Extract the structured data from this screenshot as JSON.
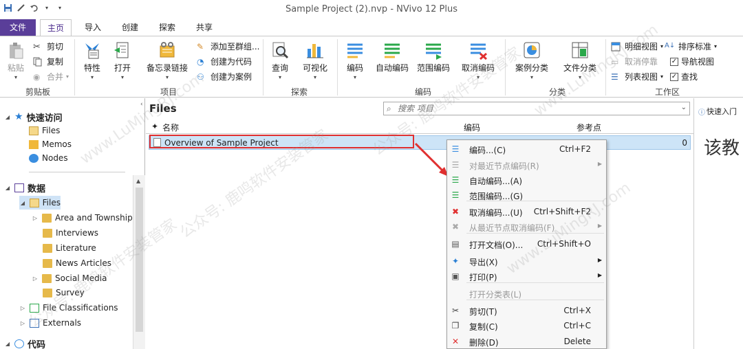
{
  "window": {
    "title": "Sample Project (2).nvp - NVivo 12 Plus"
  },
  "tabs": [
    "文件",
    "主页",
    "导入",
    "创建",
    "探索",
    "共享"
  ],
  "ribbon": {
    "clipboard": {
      "paste": "粘贴",
      "cut": "剪切",
      "copy": "复制",
      "merge": "合并",
      "group": "剪贴板"
    },
    "item": {
      "properties": "特性",
      "open": "打开",
      "memo_link": "备忘录链接",
      "add_to_group": "添加至群组...",
      "create_as_code": "创建为代码",
      "create_as_case": "创建为案例",
      "group": "项目"
    },
    "explore": {
      "query": "查询",
      "visualize": "可视化",
      "group": "探索"
    },
    "coding": {
      "code": "编码",
      "auto_code": "自动编码",
      "range_code": "范围编码",
      "uncode": "取消编码",
      "group": "编码"
    },
    "classify": {
      "case_classify": "案例分类",
      "file_classify": "文件分类",
      "group": "分类"
    },
    "workspace": {
      "detail_view": "明细视图",
      "sort": "排序标准",
      "undock": "取消停靠",
      "nav_view": "导航视图",
      "list_view": "列表视图",
      "find": "查找",
      "group": "工作区",
      "nav_view_checked": true,
      "find_checked": true
    }
  },
  "nav": {
    "quick_access": "快速访问",
    "quick_items": [
      "Files",
      "Memos",
      "Nodes"
    ],
    "data": "数据",
    "files": "Files",
    "subfolders": [
      "Area and Township",
      "Interviews",
      "Literature",
      "News Articles",
      "Social Media",
      "Survey"
    ],
    "file_classifications": "File Classifications",
    "externals": "Externals",
    "codes": "代码"
  },
  "main": {
    "title": "Files",
    "search_placeholder": "搜索 项目",
    "columns": {
      "name": "名称",
      "codes": "编码",
      "refs": "参考点"
    },
    "rows": [
      {
        "name": "Overview of Sample Project",
        "refs": "0"
      }
    ]
  },
  "context_menu": [
    {
      "label": "编码...(C)",
      "shortcut": "Ctrl+F2",
      "icon": "code-icon",
      "disabled": false,
      "sub": false
    },
    {
      "label": "对最近节点编码(R)",
      "shortcut": "",
      "icon": "recent-code-icon",
      "disabled": true,
      "sub": true
    },
    {
      "label": "自动编码...(A)",
      "shortcut": "",
      "icon": "auto-code-icon",
      "disabled": false,
      "sub": false
    },
    {
      "label": "范围编码...(G)",
      "shortcut": "",
      "icon": "range-code-icon",
      "disabled": false,
      "sub": false
    },
    {
      "label": "取消编码...(U)",
      "shortcut": "Ctrl+Shift+F2",
      "icon": "uncode-icon",
      "disabled": false,
      "sub": false
    },
    {
      "label": "从最近节点取消编码(F)",
      "shortcut": "",
      "icon": "recent-uncode-icon",
      "disabled": true,
      "sub": true
    },
    {
      "label": "打开文档(O)...",
      "shortcut": "Ctrl+Shift+O",
      "icon": "open-doc-icon",
      "disabled": false,
      "sub": false
    },
    {
      "label": "导出(X)",
      "shortcut": "",
      "icon": "export-icon",
      "disabled": false,
      "sub": true
    },
    {
      "label": "打印(P)",
      "shortcut": "",
      "icon": "print-icon",
      "disabled": false,
      "sub": true
    },
    {
      "label": "打开分类表(L)",
      "shortcut": "",
      "icon": "",
      "disabled": true,
      "sub": false
    },
    {
      "label": "剪切(T)",
      "shortcut": "Ctrl+X",
      "icon": "cut-icon",
      "disabled": false,
      "sub": false
    },
    {
      "label": "复制(C)",
      "shortcut": "Ctrl+C",
      "icon": "copy-icon",
      "disabled": false,
      "sub": false
    },
    {
      "label": "删除(D)",
      "shortcut": "Delete",
      "icon": "delete-icon",
      "disabled": false,
      "sub": false
    }
  ],
  "right_pane": {
    "quick_start": "快速入门",
    "heading": "该教"
  },
  "watermark": {
    "a": "www.LuMingRJ.com",
    "b": "公众号: 鹿鸣软件安装管家"
  },
  "colors": {
    "file_tab": "#5a3e99",
    "selection": "#cde4f7",
    "highlight": "#e03030"
  }
}
